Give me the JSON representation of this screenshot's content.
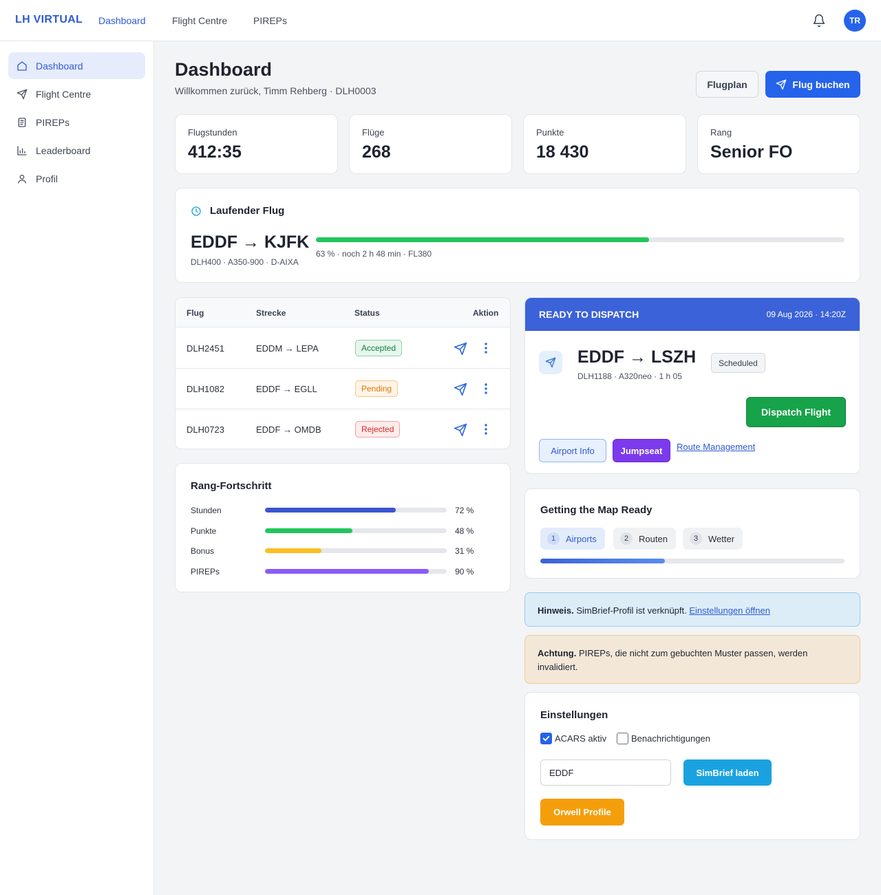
{
  "brand": "LH VIRTUAL",
  "topnav": [
    {
      "label": "Dashboard",
      "active": true
    },
    {
      "label": "Flight Centre",
      "active": false
    },
    {
      "label": "PIREPs",
      "active": false
    }
  ],
  "user": {
    "initials": "TR"
  },
  "sidebar": {
    "items": [
      {
        "label": "Dashboard",
        "icon": "home-icon",
        "active": true
      },
      {
        "label": "Flight Centre",
        "icon": "send-icon",
        "active": false
      },
      {
        "label": "PIREPs",
        "icon": "document-icon",
        "active": false
      },
      {
        "label": "Leaderboard",
        "icon": "bar-chart-icon",
        "active": false
      },
      {
        "label": "Profil",
        "icon": "user-icon",
        "active": false
      }
    ]
  },
  "header": {
    "title": "Dashboard",
    "subtitle": "Willkommen zurück, Timm Rehberg · DLH0003",
    "flugplan_label": "Flugplan",
    "book_label": "Flug buchen"
  },
  "stats": [
    {
      "label": "Flugstunden",
      "value": "412:35"
    },
    {
      "label": "Flüge",
      "value": "268"
    },
    {
      "label": "Punkte",
      "value": "18 430"
    },
    {
      "label": "Rang",
      "value": "Senior FO"
    }
  ],
  "current_flight": {
    "title": "Laufender Flug",
    "route": "EDDF → KJFK",
    "meta": "DLH400 · A350-900 · D-AIXA",
    "progress": 0.63,
    "progress_text": "63 % · noch 2 h 48 min · FL380",
    "accent": "#22c55e"
  },
  "bookings": {
    "headers": [
      "Flug",
      "Strecke",
      "Status",
      "Aktion"
    ],
    "rows": [
      {
        "flight": "DLH2451",
        "route": "EDDM → LEPA",
        "status": "Accepted"
      },
      {
        "flight": "DLH1082",
        "route": "EDDF → EGLL",
        "status": "Pending"
      },
      {
        "flight": "DLH0723",
        "route": "EDDF → OMDB",
        "status": "Rejected"
      }
    ]
  },
  "rank_progress": {
    "title": "Rang-Fortschritt",
    "items": [
      {
        "label": "Stunden",
        "value": 0.72,
        "text": "72 %",
        "color": "#3b55d0"
      },
      {
        "label": "Punkte",
        "value": 0.48,
        "text": "48 %",
        "color": "#22c55e"
      },
      {
        "label": "Bonus",
        "value": 0.31,
        "text": "31 %",
        "color": "#fbbf24"
      },
      {
        "label": "PIREPs",
        "value": 0.9,
        "text": "90 %",
        "color": "#8b5cf6"
      }
    ]
  },
  "dispatch": {
    "header": "READY TO DISPATCH",
    "date": "09 Aug 2026 · 14:20Z",
    "route": "EDDF → LSZH",
    "meta": "DLH1188 · A320neo · 1 h 05",
    "status": "Scheduled",
    "dispatch_label": "Dispatch Flight",
    "airport_info_label": "Airport Info",
    "jumpseat_label": "Jumpseat",
    "route_mgmt_label": "Route Management"
  },
  "map_ready": {
    "title": "Getting the Map Ready",
    "steps": [
      {
        "num": "1",
        "label": "Airports",
        "active": true
      },
      {
        "num": "2",
        "label": "Routen",
        "active": false
      },
      {
        "num": "3",
        "label": "Wetter",
        "active": false
      }
    ],
    "progress": 0.41
  },
  "alerts": {
    "info_bold": "Hinweis.",
    "info_text": " SimBrief-Profil ist verknüpft. ",
    "info_link": "Einstellungen öffnen",
    "warn_bold": "Achtung.",
    "warn_text": " PIREPs, die nicht zum gebuchten Muster passen, werden invalidiert."
  },
  "settings": {
    "title": "Einstellungen",
    "acars_label": "ACARS aktiv",
    "acars_checked": true,
    "notify_label": "Benachrichtigungen",
    "notify_checked": false,
    "airport_value": "EDDF",
    "simbrief_label": "SimBrief laden",
    "orwell_label": "Orwell Profile"
  }
}
